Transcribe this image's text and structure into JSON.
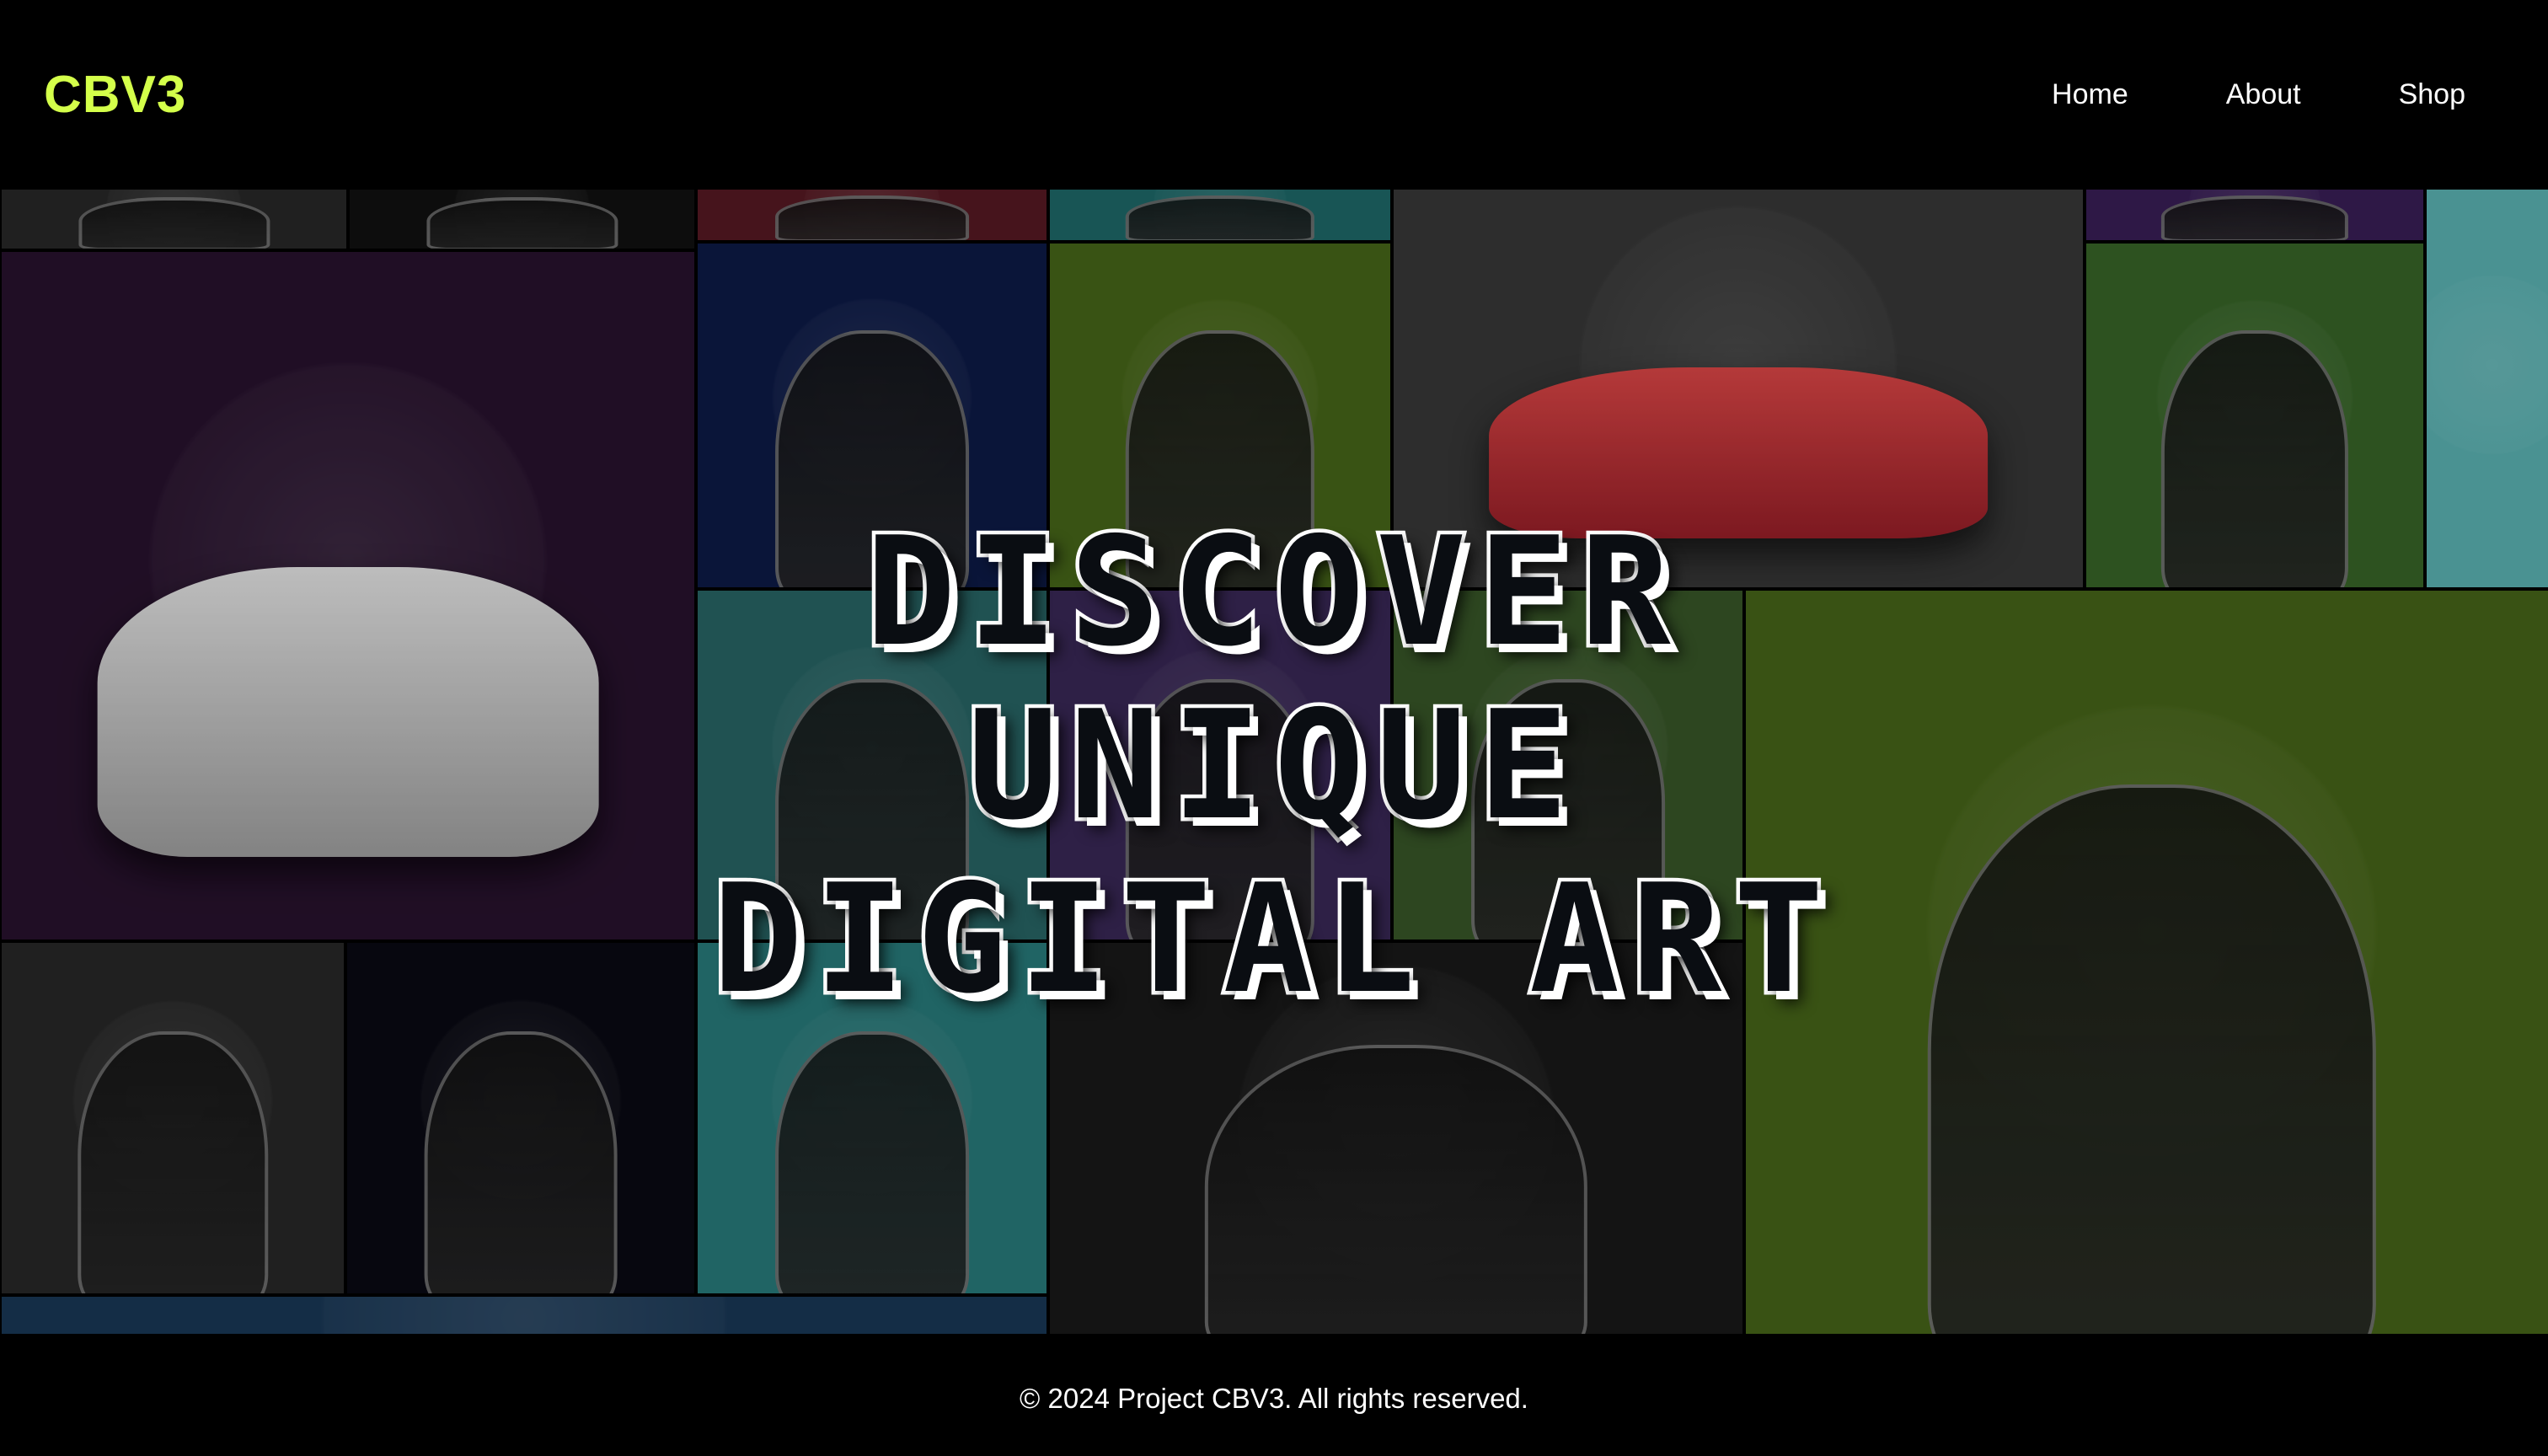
{
  "header": {
    "logo": "CBV3",
    "nav": [
      {
        "label": "Home"
      },
      {
        "label": "About"
      },
      {
        "label": "Shop"
      }
    ]
  },
  "hero": {
    "lines": [
      "DISCOVER",
      "UNIQUE",
      "DIGITAL ART"
    ]
  },
  "gallery": {
    "tiles": [
      {
        "name": "tile-white-character-top",
        "color": "#2a2a2a",
        "art": "white-fur-icon"
      },
      {
        "name": "tile-white-character-v-badge",
        "color": "#111111",
        "art": "white-fur-icon"
      },
      {
        "name": "tile-dark-character-red",
        "color": "#5a1a24",
        "art": "dark-character-icon"
      },
      {
        "name": "tile-teal-character-top",
        "color": "#1f6e6e",
        "art": "teal-character-icon"
      },
      {
        "name": "tile-red-mustang-car",
        "color": "#3a3a3a",
        "art": "car-icon"
      },
      {
        "name": "tile-purple-character-top",
        "color": "#3b1f5a",
        "art": "purple-character-icon"
      },
      {
        "name": "tile-teal-edge",
        "color": "#5fbcbc",
        "art": "teal-edge"
      },
      {
        "name": "tile-white-bentley-crypto-bros",
        "color": "#2a1330",
        "art": "car-icon"
      },
      {
        "name": "tile-fox-circuit-brain",
        "color": "#0e1c4a",
        "art": "fox-icon"
      },
      {
        "name": "tile-wolf-diamond-handz",
        "color": "#4a6b1a",
        "art": "wolf-icon"
      },
      {
        "name": "tile-green-purple-v-wolf",
        "color": "#3a6a2a",
        "art": "wolf-icon"
      },
      {
        "name": "tile-bulldog-red-jacket",
        "color": "#2a6a6a",
        "art": "dog-icon"
      },
      {
        "name": "tile-trophy-character",
        "color": "#3c2a5a",
        "art": "trophy-icon"
      },
      {
        "name": "tile-red-cap-character",
        "color": "#3a5a2a",
        "art": "character-icon"
      },
      {
        "name": "tile-big-dog-green-purple",
        "color": "#4a6a1a",
        "art": "dog-icon"
      },
      {
        "name": "tile-black-wolf-grey",
        "color": "#2a2a2a",
        "art": "wolf-icon"
      },
      {
        "name": "tile-blue-red-wolf-planet",
        "color": "#0a0a14",
        "art": "wolf-icon"
      },
      {
        "name": "tile-black-dog-green-suit",
        "color": "#2a8080",
        "art": "dog-icon"
      },
      {
        "name": "tile-tiger-headband",
        "color": "#1a1a1a",
        "art": "tiger-icon"
      },
      {
        "name": "tile-bottom-strip",
        "color": "#1a3a5a",
        "art": "strip"
      }
    ]
  },
  "footer": {
    "copyright": "© 2024 Project CBV3. All rights reserved."
  },
  "colors": {
    "accent": "#d4ff4a",
    "background": "#000000",
    "hero_text": "#ffffff"
  }
}
